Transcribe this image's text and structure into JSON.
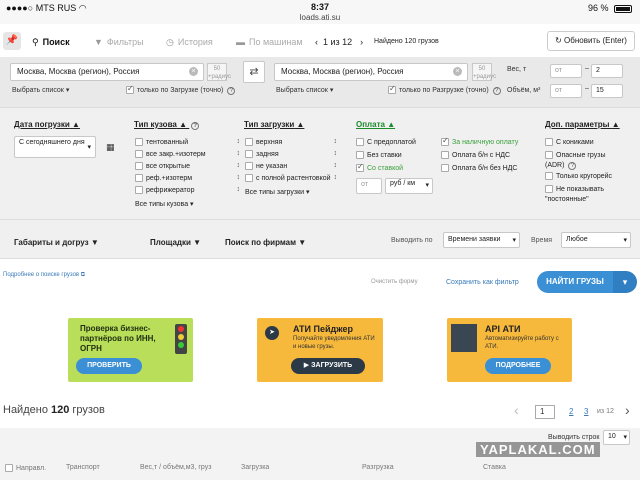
{
  "status_bar": {
    "carrier": "MTS RUS",
    "time": "8:37",
    "url": "loads.ati.su",
    "battery": "96 %"
  },
  "toolbar": {
    "search": "Поиск",
    "filters": "Фильтры",
    "history": "История",
    "by_cars": "По машинам",
    "page_indicator": "1 из 12",
    "found_count": "Найдено 120 грузов",
    "refresh": "Обновить (Enter)"
  },
  "route": {
    "from_value": "Москва, Москва (регион), Россия",
    "to_value": "Москва, Москва (регион), Россия",
    "radius_value": "50",
    "radius_unit": "+радиус",
    "pick_list": "Выбрать список",
    "only_loading": "только по Загрузке (точно)",
    "only_unloading": "только по Разгрузке (точно)",
    "weight_label": "Вес, т",
    "volume_label": "Объём, м³",
    "from_placeholder": "от",
    "weight_to": "2",
    "volume_to": "15"
  },
  "filters": {
    "date_header": "Дата погрузки",
    "date_value": "С сегодняшнего дня",
    "body_header": "Тип кузова",
    "body_options": [
      "тентованный",
      "все закр.+изотерм",
      "все открытые",
      "реф.+изотерм",
      "рефрижератор"
    ],
    "body_all": "Все типы кузова",
    "load_header": "Тип загрузки",
    "load_options": [
      "верхняя",
      "задняя",
      "не указан",
      "с полной растентовкой"
    ],
    "load_all": "Все типы загрузки",
    "pay_header": "Оплата",
    "pay_col1": [
      "С предоплатой",
      "Без ставки",
      "Со ставкой"
    ],
    "pay_col2": [
      "За наличную оплату",
      "Оплата б/н с НДС",
      "Оплата б/н без НДС"
    ],
    "pay_from": "от",
    "pay_unit": "руб / км",
    "extra_header": "Доп. параметры",
    "extra_options": [
      "С кониками",
      "Опасные грузы (ADR)",
      "Только кругорейс",
      "Не показывать \"постоянные\""
    ]
  },
  "bottom_filters": {
    "dims": "Габариты и догруз",
    "platforms": "Площадки",
    "firms": "Поиск по фирмам",
    "output_label": "Выводить по",
    "output_value": "Времени заявки",
    "time_label": "Время",
    "time_value": "Любое"
  },
  "actions": {
    "more_link": "Подробнее о поиске грузов",
    "clear_form": "Очистить форму",
    "save_filter": "Сохранить как фильтр",
    "find": "НАЙТИ ГРУЗЫ"
  },
  "banners": [
    {
      "title": "Проверка бизнес-партнёров по ИНН, ОГРН",
      "button": "ПРОВЕРИТЬ"
    },
    {
      "title": "АТИ Пейджер",
      "text": "Получайте уведомления АТИ и новые грузы.",
      "button": "ЗАГРУЗИТЬ"
    },
    {
      "title": "API АТИ",
      "text": "Автоматизируйте работу с АТИ.",
      "button": "ПОДРОБНЕЕ"
    }
  ],
  "results": {
    "found_prefix": "Найдено",
    "found_number": "120",
    "found_suffix": "грузов",
    "page_current": "1",
    "page_2": "2",
    "page_3": "3",
    "page_of": "из 12",
    "rows_label": "Выводить строк",
    "rows_value": "10",
    "columns": [
      "Направл.",
      "Транспорт",
      "Вес,т / объём,м3, груз",
      "Загрузка",
      "Разгрузка",
      "Ставка"
    ]
  },
  "watermark": "YAPLAKAL.COM",
  "colors": {
    "accent_blue": "#3b8fd4",
    "green": "#1a8a2a",
    "banner_green": "#b9df5a",
    "banner_orange": "#f7b93c",
    "banner_dark": "#3b8fd4"
  }
}
